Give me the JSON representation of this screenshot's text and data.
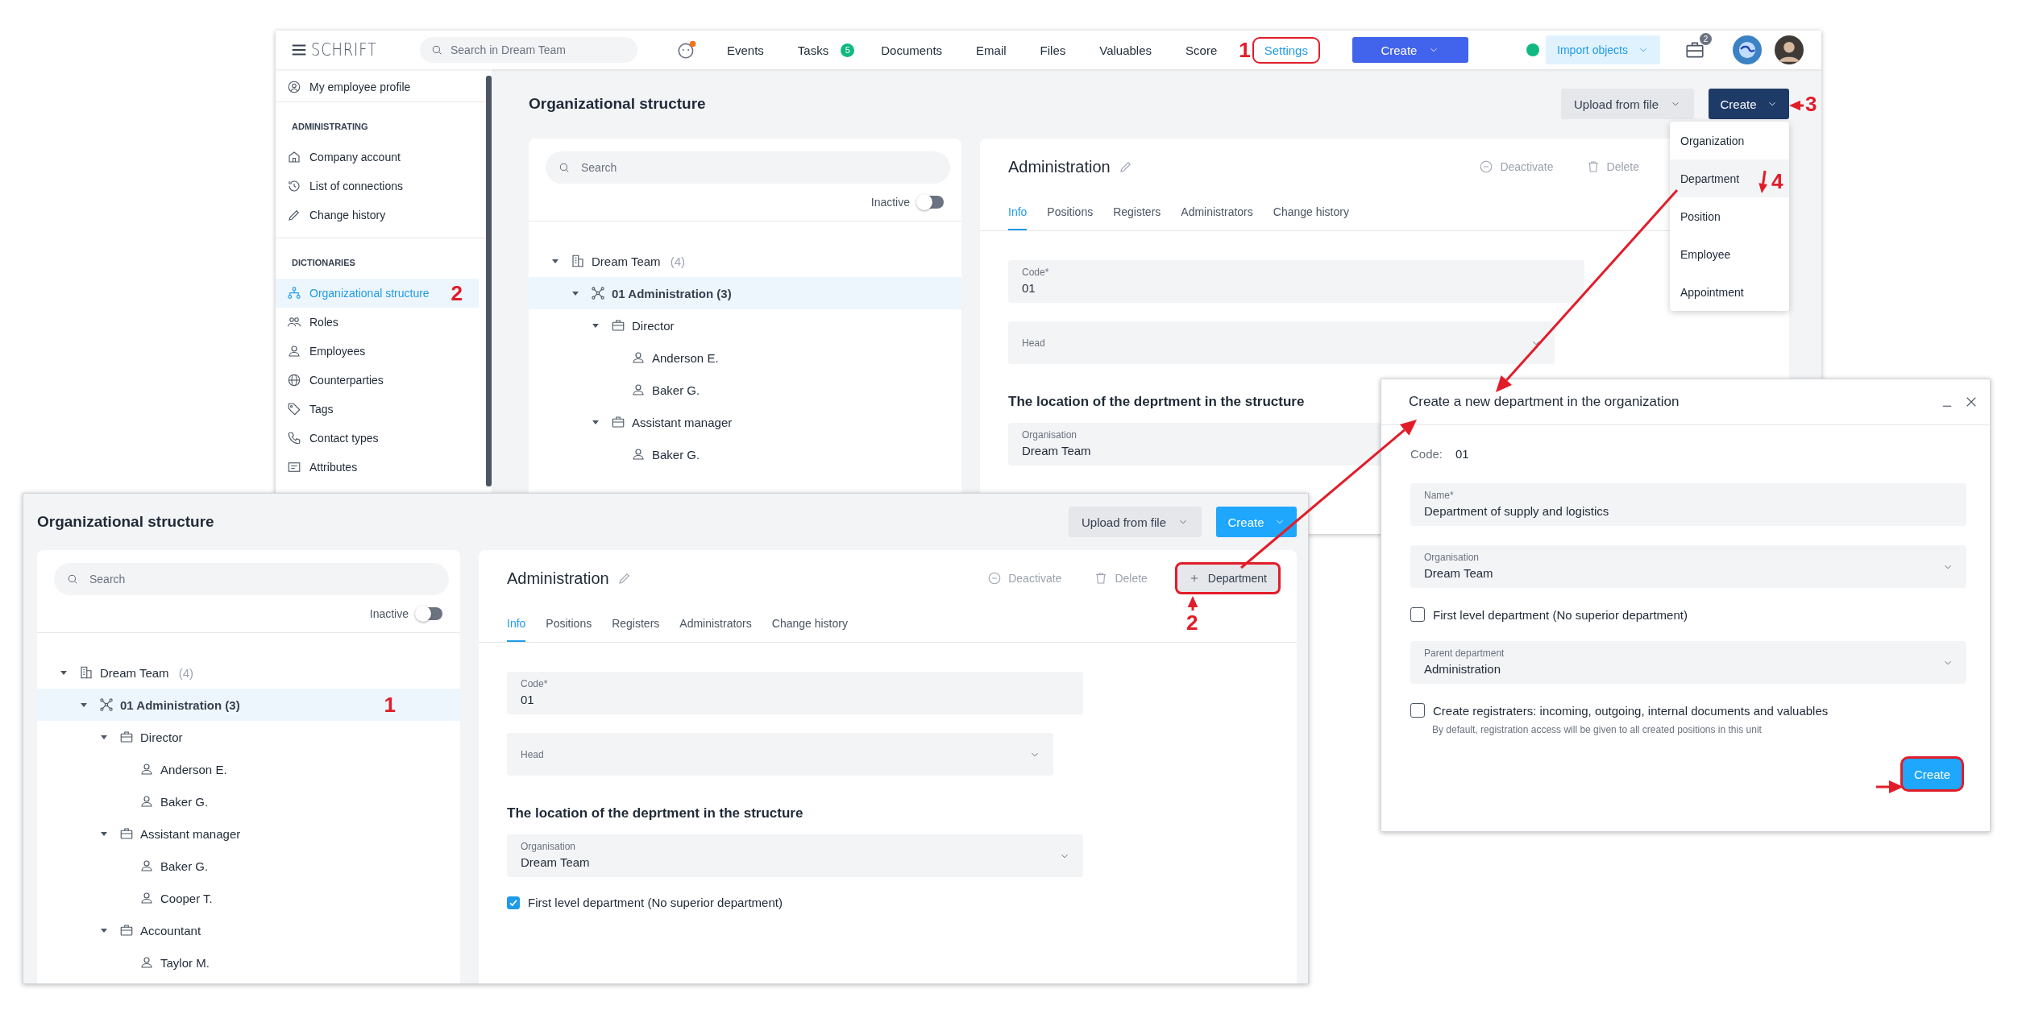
{
  "back_window": {
    "topbar": {
      "logo": "SCHRIFT",
      "search_placeholder": "Search in Dream Team",
      "nav": [
        {
          "label": "Events",
          "selected": false,
          "highlighted": false
        },
        {
          "label": "Tasks",
          "badge": "5",
          "selected": false,
          "highlighted": false
        },
        {
          "label": "Documents",
          "selected": false,
          "highlighted": false
        },
        {
          "label": "Email",
          "selected": false,
          "highlighted": false
        },
        {
          "label": "Files",
          "selected": false,
          "highlighted": false
        },
        {
          "label": "Valuables",
          "selected": false,
          "highlighted": false
        },
        {
          "label": "Score",
          "selected": false,
          "highlighted": false
        },
        {
          "label": "Settings",
          "selected": true,
          "highlighted": true,
          "step": "1"
        }
      ],
      "create_button": "Create",
      "import_button": "Import objects",
      "inbox_badge": "2"
    },
    "sidebar": {
      "profile": {
        "label": "My employee profile",
        "selected": false
      },
      "sections": [
        {
          "heading": "ADMINISTRATING",
          "items": [
            {
              "label": "Company account",
              "selected": false
            },
            {
              "label": "List of connections",
              "selected": false
            },
            {
              "label": "Change history",
              "selected": false
            }
          ]
        },
        {
          "heading": "DICTIONARIES",
          "items": [
            {
              "label": "Organizational structure",
              "selected": true,
              "step": "2"
            },
            {
              "label": "Roles",
              "selected": false
            },
            {
              "label": "Employees",
              "selected": false
            },
            {
              "label": "Counterparties",
              "selected": false
            },
            {
              "label": "Tags",
              "selected": false
            },
            {
              "label": "Contact types",
              "selected": false
            },
            {
              "label": "Attributes",
              "selected": false
            }
          ]
        }
      ]
    },
    "page": {
      "title": "Organizational structure",
      "upload_button": "Upload from file",
      "create_button": {
        "label": "Create",
        "open": true
      },
      "create_menu": [
        {
          "label": "Organization",
          "selected": false
        },
        {
          "label": "Department",
          "selected": true
        },
        {
          "label": "Position",
          "selected": false
        },
        {
          "label": "Employee",
          "selected": false
        },
        {
          "label": "Appointment",
          "selected": false
        }
      ],
      "search_placeholder": "Search",
      "inactive_toggle": {
        "label": "Inactive",
        "on": false
      },
      "tree": [
        {
          "label": "Dream Team",
          "count": "(4)",
          "kind": "organization",
          "expanded": true,
          "selected": false,
          "children": [
            {
              "label": "01 Administration (3)",
              "kind": "department",
              "expanded": true,
              "selected": true,
              "children": [
                {
                  "label": "Director",
                  "kind": "position",
                  "expanded": true,
                  "selected": false,
                  "children": [
                    {
                      "label": "Anderson E.",
                      "kind": "employee",
                      "selected": false
                    },
                    {
                      "label": "Baker G.",
                      "kind": "employee",
                      "selected": false
                    }
                  ]
                },
                {
                  "label": "Assistant manager",
                  "kind": "position",
                  "expanded": true,
                  "selected": false,
                  "children": [
                    {
                      "label": "Baker G.",
                      "kind": "employee",
                      "selected": false
                    }
                  ]
                }
              ]
            }
          ]
        }
      ],
      "detail": {
        "title": "Administration",
        "actions": [
          {
            "label": "Deactivate",
            "kind": "deactivate"
          },
          {
            "label": "Delete",
            "kind": "delete"
          }
        ],
        "tabs": [
          {
            "label": "Info",
            "selected": true
          },
          {
            "label": "Positions",
            "selected": false
          },
          {
            "label": "Registers",
            "selected": false
          },
          {
            "label": "Administrators",
            "selected": false
          },
          {
            "label": "Change history",
            "selected": false
          }
        ],
        "fields": [
          {
            "label": "Code*",
            "value": "01",
            "kind": "text"
          },
          {
            "label": "Head",
            "kind": "select"
          }
        ],
        "section_title": "The location of the deprtment in the structure",
        "location_fields": [
          {
            "label": "Organisation",
            "value": "Dream Team"
          }
        ]
      }
    }
  },
  "front_window": {
    "page": {
      "title": "Organizational structure",
      "upload_button": "Upload from file",
      "create_button": {
        "label": "Create",
        "open": false
      },
      "search_placeholder": "Search",
      "inactive_toggle": {
        "label": "Inactive",
        "on": false
      },
      "tree": [
        {
          "label": "Dream Team",
          "count": "(4)",
          "kind": "organization",
          "expanded": true,
          "selected": false,
          "children": [
            {
              "label": "01 Administration (3)",
              "kind": "department",
              "expanded": true,
              "selected": true,
              "step": "1",
              "children": [
                {
                  "label": "Director",
                  "kind": "position",
                  "expanded": true,
                  "selected": false,
                  "children": [
                    {
                      "label": "Anderson E.",
                      "kind": "employee",
                      "selected": false
                    },
                    {
                      "label": "Baker G.",
                      "kind": "employee",
                      "selected": false
                    }
                  ]
                },
                {
                  "label": "Assistant manager",
                  "kind": "position",
                  "expanded": true,
                  "selected": false,
                  "children": [
                    {
                      "label": "Baker G.",
                      "kind": "employee",
                      "selected": false
                    },
                    {
                      "label": "Cooper T.",
                      "kind": "employee",
                      "selected": false
                    }
                  ]
                },
                {
                  "label": "Accountant",
                  "kind": "position",
                  "expanded": true,
                  "selected": false,
                  "children": [
                    {
                      "label": "Taylor M.",
                      "kind": "employee",
                      "selected": false
                    }
                  ]
                }
              ]
            }
          ]
        }
      ],
      "detail": {
        "title": "Administration",
        "actions": [
          {
            "label": "Deactivate",
            "kind": "deactivate"
          },
          {
            "label": "Delete",
            "kind": "delete"
          }
        ],
        "add_button": {
          "label": "Department",
          "highlighted": true
        },
        "tabs": [
          {
            "label": "Info",
            "selected": true
          },
          {
            "label": "Positions",
            "selected": false
          },
          {
            "label": "Registers",
            "selected": false
          },
          {
            "label": "Administrators",
            "selected": false
          },
          {
            "label": "Change history",
            "selected": false
          }
        ],
        "fields": [
          {
            "label": "Code*",
            "value": "01",
            "kind": "text"
          },
          {
            "label": "Head",
            "kind": "select"
          }
        ],
        "section_title": "The location of the deprtment in the structure",
        "location_fields": [
          {
            "label": "Organisation",
            "value": "Dream Team",
            "kind": "select"
          }
        ],
        "first_level": {
          "label": "First level department (No superior department)",
          "checked": true
        }
      }
    }
  },
  "dialog": {
    "title": "Create a new department in the organization",
    "code_label": "Code:",
    "code_value": "01",
    "fields": [
      {
        "label": "Name*",
        "value": "Department of supply and logistics",
        "kind": "text"
      },
      {
        "label": "Organisation",
        "value": "Dream Team",
        "kind": "select"
      }
    ],
    "first_level": {
      "label": "First level department (No superior department)",
      "checked": false
    },
    "parent_field": {
      "label": "Parent department",
      "value": "Administration",
      "kind": "select"
    },
    "registers": {
      "label": "Create registraters: incoming, outgoing, internal documents and valuables",
      "checked": false,
      "hint": "By default, registration access will be given to all created positions in this unit"
    },
    "create_button": {
      "label": "Create",
      "highlighted": true
    }
  },
  "annotations": [
    {
      "text": "3"
    },
    {
      "text": "4"
    },
    {
      "text": "2"
    }
  ]
}
